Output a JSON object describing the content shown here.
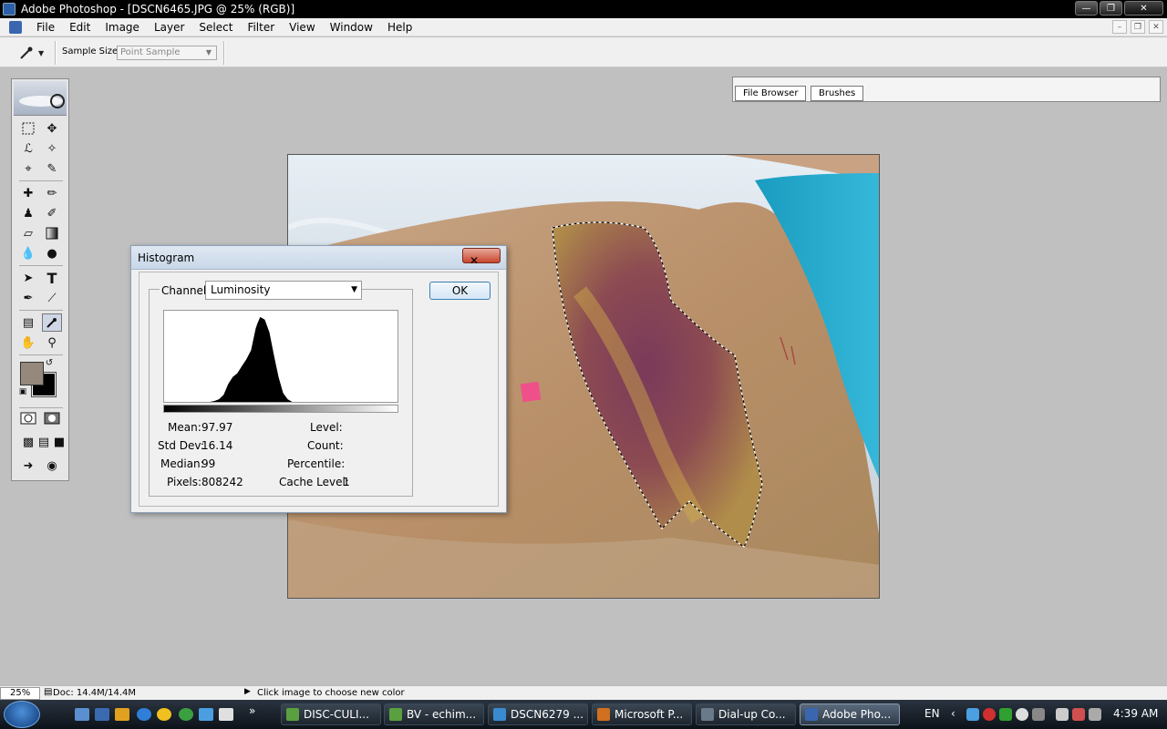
{
  "window": {
    "title": "Adobe Photoshop - [DSCN6465.JPG @ 25% (RGB)]"
  },
  "menu": [
    "File",
    "Edit",
    "Image",
    "Layer",
    "Select",
    "Filter",
    "View",
    "Window",
    "Help"
  ],
  "options": {
    "sample_size_label": "Sample Size:",
    "sample_size_value": "Point Sample"
  },
  "palette_well": {
    "tabs": [
      "File Browser",
      "Brushes"
    ]
  },
  "toolbox": {
    "foreground_color": "#94897a",
    "background_color": "#000000",
    "tools": [
      "marquee",
      "move",
      "lasso",
      "magic-wand",
      "crop",
      "slice",
      "healing-brush",
      "brush",
      "clone-stamp",
      "history-brush",
      "eraser",
      "gradient",
      "blur",
      "dodge",
      "path-selection",
      "type",
      "pen",
      "line",
      "notes",
      "eyedropper",
      "hand",
      "zoom"
    ]
  },
  "histogram": {
    "title": "Histogram",
    "close": "✕",
    "channel_label": "Channel:",
    "channel_value": "Luminosity",
    "ok_label": "OK",
    "mean_label": "Mean:",
    "mean": "97.97",
    "stddev_label": "Std Dev:",
    "stddev": "16.14",
    "median_label": "Median:",
    "median": "99",
    "pixels_label": "Pixels:",
    "pixels": "808242",
    "level_label": "Level:",
    "count_label": "Count:",
    "percentile_label": "Percentile:",
    "cache_label": "Cache Level:",
    "cache": "1"
  },
  "chart_data": {
    "type": "area",
    "x": [
      0,
      40,
      50,
      55,
      60,
      65,
      70,
      75,
      80,
      85,
      90,
      95,
      100,
      102,
      105,
      110,
      115,
      120,
      125,
      130,
      135,
      140,
      150,
      255
    ],
    "values": [
      0,
      0,
      0,
      1,
      3,
      8,
      20,
      28,
      32,
      40,
      48,
      58,
      82,
      88,
      95,
      92,
      78,
      52,
      28,
      10,
      3,
      0,
      0,
      0
    ],
    "ylim": [
      0,
      100
    ],
    "xlim": [
      0,
      255
    ]
  },
  "status": {
    "zoom": "25%",
    "doc": "Doc: 14.4M/14.4M",
    "hint": "Click image to choose new color"
  },
  "taskbar": {
    "tasks": [
      "DISC-CULI...",
      "BV - echim...",
      "DSCN6279 ...",
      "Microsoft P...",
      "Dial-up Co...",
      "Adobe Pho..."
    ],
    "lang": "EN",
    "clock": "4:39 AM"
  }
}
